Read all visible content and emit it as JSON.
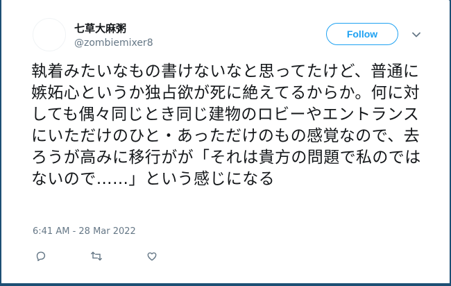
{
  "tweet": {
    "display_name": "七草大麻粥",
    "handle": "@zombiemixer8",
    "follow_label": "Follow",
    "text": "執着みたいなもの書けないなと思ってたけど、普通に嫉妬心というか独占欲が死に絶えてるからか。何に対しても偶々同じとき同じ建物のロビーやエントランスにいただけのひと・あっただけのもの感覚なので、去ろうが高みに移行がが「それは貴方の問題で私のではないので……」という感じになる",
    "timestamp": "6:41 AM - 28 Mar 2022",
    "actions": {
      "reply_icon": "reply-icon",
      "retweet_icon": "retweet-icon",
      "like_icon": "heart-icon"
    }
  },
  "colors": {
    "background": "#1d4f74",
    "card": "#ffffff",
    "accent": "#1da1f2",
    "text": "#14171a",
    "muted": "#657786"
  },
  "icons": {
    "caret": "chevron-down-icon"
  }
}
